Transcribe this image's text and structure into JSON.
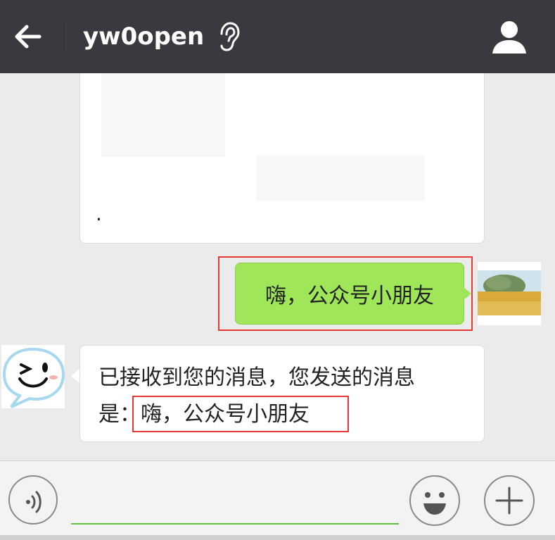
{
  "header": {
    "title": "yw0open"
  },
  "messages": {
    "card_dot": ".",
    "outgoing": "嗨，公众号小朋友",
    "incoming_line1": "已接收到您的消息，您发送的消息",
    "incoming_prefix": "是：",
    "incoming_quote": "嗨，公众号小朋友"
  },
  "input": {
    "value": "",
    "placeholder": ""
  },
  "colors": {
    "topbar": "#393a3f",
    "outgoing_bubble": "#9fe658",
    "highlight": "#e53935",
    "input_underline": "#5cbf42"
  },
  "icons": {
    "back": "arrow-left-icon",
    "earpiece": "ear-icon",
    "profile": "person-icon",
    "voice": "voice-icon",
    "emoji": "smiley-icon",
    "more": "plus-icon"
  }
}
